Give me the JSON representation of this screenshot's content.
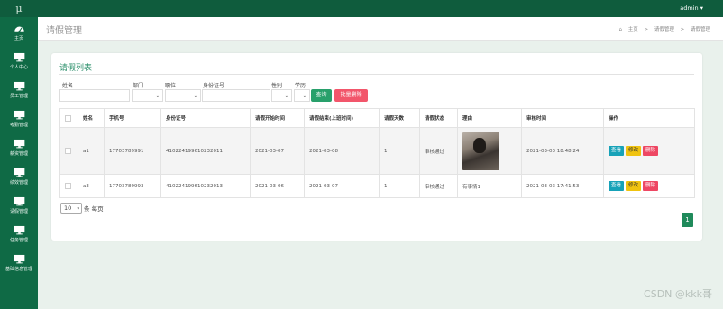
{
  "app": {
    "logo": "μ",
    "user_menu": "admin ▾"
  },
  "sidebar": {
    "items": [
      {
        "label": "主页",
        "icon": "dashboard-icon"
      },
      {
        "label": "个人中心",
        "icon": "monitor-icon"
      },
      {
        "label": "员工管理",
        "icon": "monitor-icon"
      },
      {
        "label": "考勤管理",
        "icon": "monitor-icon"
      },
      {
        "label": "薪资管理",
        "icon": "monitor-icon"
      },
      {
        "label": "绩效管理",
        "icon": "monitor-icon"
      },
      {
        "label": "请假管理",
        "icon": "monitor-icon"
      },
      {
        "label": "任务管理",
        "icon": "monitor-icon"
      },
      {
        "label": "基础信息管理",
        "icon": "monitor-icon"
      }
    ]
  },
  "header": {
    "title": "请假管理",
    "breadcrumb": [
      "主页",
      ">",
      "请假管理",
      ">",
      "请假管理"
    ]
  },
  "card": {
    "title": "请假列表"
  },
  "filters": {
    "name_label": "姓名",
    "dept_label": "部门",
    "position_label": "职位",
    "idcard_label": "身份证号",
    "gender_label": "性别",
    "education_label": "学历",
    "search_button": "查询",
    "batch_delete_button": "批量删除"
  },
  "table": {
    "headers": [
      "",
      "姓名",
      "手机号",
      "身份证号",
      "请假开始时间",
      "请假结束(上班时间)",
      "请假天数",
      "请假状态",
      "理由",
      "审核时间",
      "操作"
    ],
    "rows": [
      {
        "name": "a1",
        "phone": "17703789991",
        "idcard": "410224199610232011",
        "start": "2021-03-07",
        "end": "2021-03-08",
        "days": "1",
        "status": "审核通过",
        "reason": "",
        "audit_time": "2021-03-03 18:48:24"
      },
      {
        "name": "a3",
        "phone": "17703789993",
        "idcard": "410224199610232013",
        "start": "2021-03-06",
        "end": "2021-03-07",
        "days": "1",
        "status": "审核通过",
        "reason": "有事情1",
        "audit_time": "2021-03-03 17:41:53"
      }
    ],
    "actions": {
      "view": "查看",
      "edit": "修改",
      "delete": "删除"
    }
  },
  "pagination": {
    "page_size": "10",
    "page_size_suffix": "条 每页",
    "current_page": "1"
  },
  "watermark": "CSDN @kkk哥",
  "colors": {
    "primary": "#0f6a45",
    "accent": "#28a06b",
    "danger": "#f2566b",
    "info": "#17a2b8",
    "warning": "#f0c30f"
  }
}
